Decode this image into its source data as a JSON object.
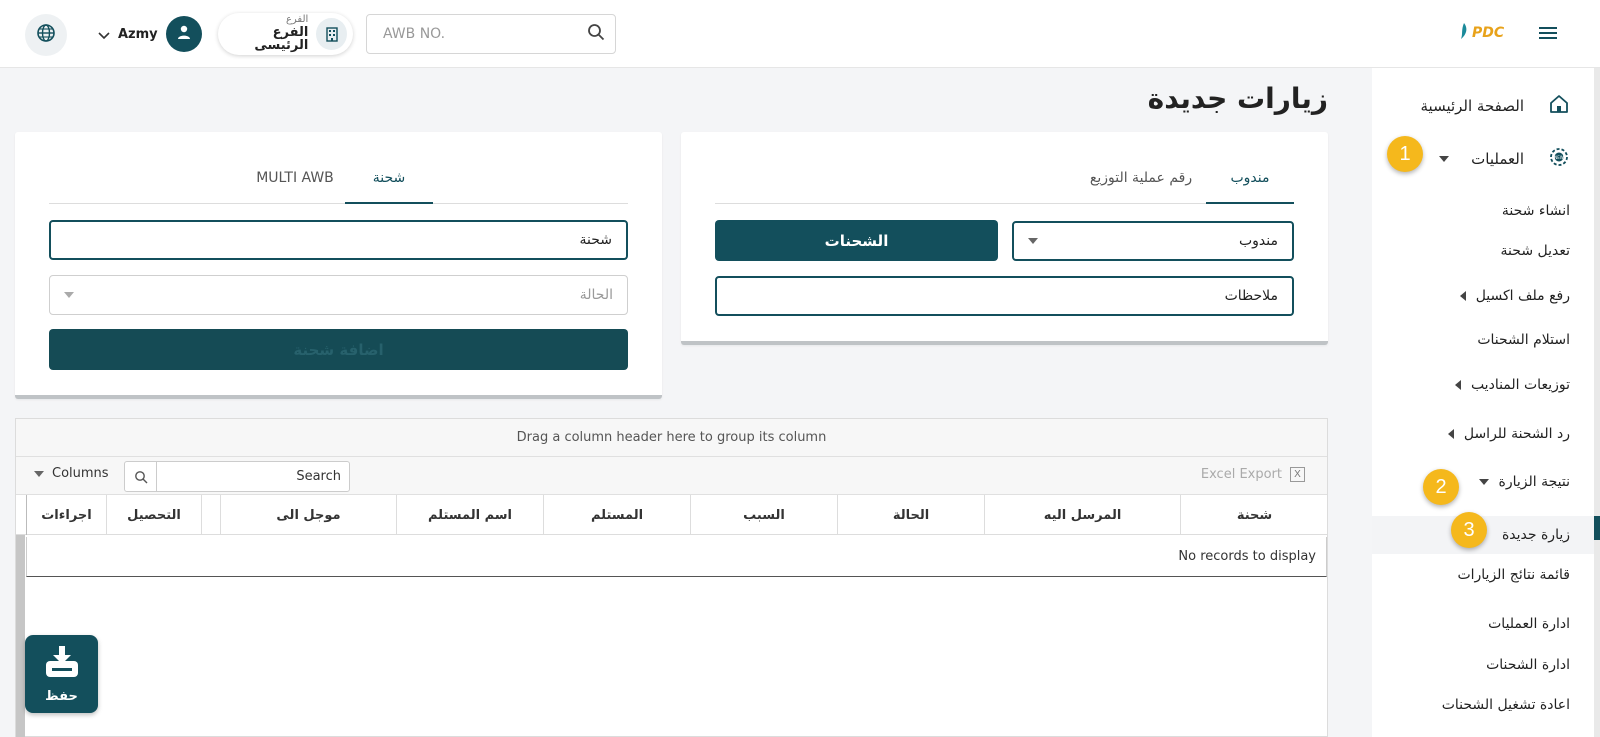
{
  "header": {
    "user_name": "Azmy",
    "branch_label": "الفرع",
    "branch_value": "الفرع الرئيسى",
    "awb_placeholder": "AWB NO.",
    "logo_text": "PDC"
  },
  "sidebar": {
    "home": "الصفحة الرئيسية",
    "operations": "العمليات",
    "items": [
      "انشاء شحنة",
      "تعديل شحنة",
      "رفع ملف اكسيل",
      "استلام الشحنات",
      "توزيعات المناديب",
      "رد الشحنة للراسل",
      "نتيجة الزيارة",
      "زيارة جديدة",
      "قائمة نتائج الزيارات",
      "ادارة العمليات",
      "ادارة الشحنات",
      "اعادة تشغيل الشحنات"
    ],
    "badges": [
      "1",
      "2",
      "3"
    ]
  },
  "page": {
    "title": "زيارات جديدة"
  },
  "right_card": {
    "tabs": [
      "مندوب",
      "رقم عملية التوزيع"
    ],
    "agent_select": "مندوب",
    "shipments_button": "الشحنات",
    "notes_field": "ملاحظات"
  },
  "left_card": {
    "tabs": [
      "شحنة",
      "MULTI AWB"
    ],
    "shipment_field": "شحنة",
    "status_placeholder": "الحالة",
    "add_button": "اضافة شحنة"
  },
  "grid": {
    "group_hint": "Drag a column header here to group its column",
    "columns_label": "Columns",
    "search_label": "Search",
    "excel_label": "Excel Export",
    "excel_icon": "X",
    "headers": [
      "شحنة",
      "المرسل اليه",
      "الحالة",
      "السبب",
      "المستلم",
      "اسم المستلم",
      "موجل الى",
      "",
      "التحصيل",
      "اجراءات"
    ],
    "empty_text": "No records to display"
  },
  "save": {
    "label": "حفظ"
  },
  "colors": {
    "primary": "#134f5c",
    "badge": "#f5b81c",
    "logo": "#e8a21a"
  }
}
